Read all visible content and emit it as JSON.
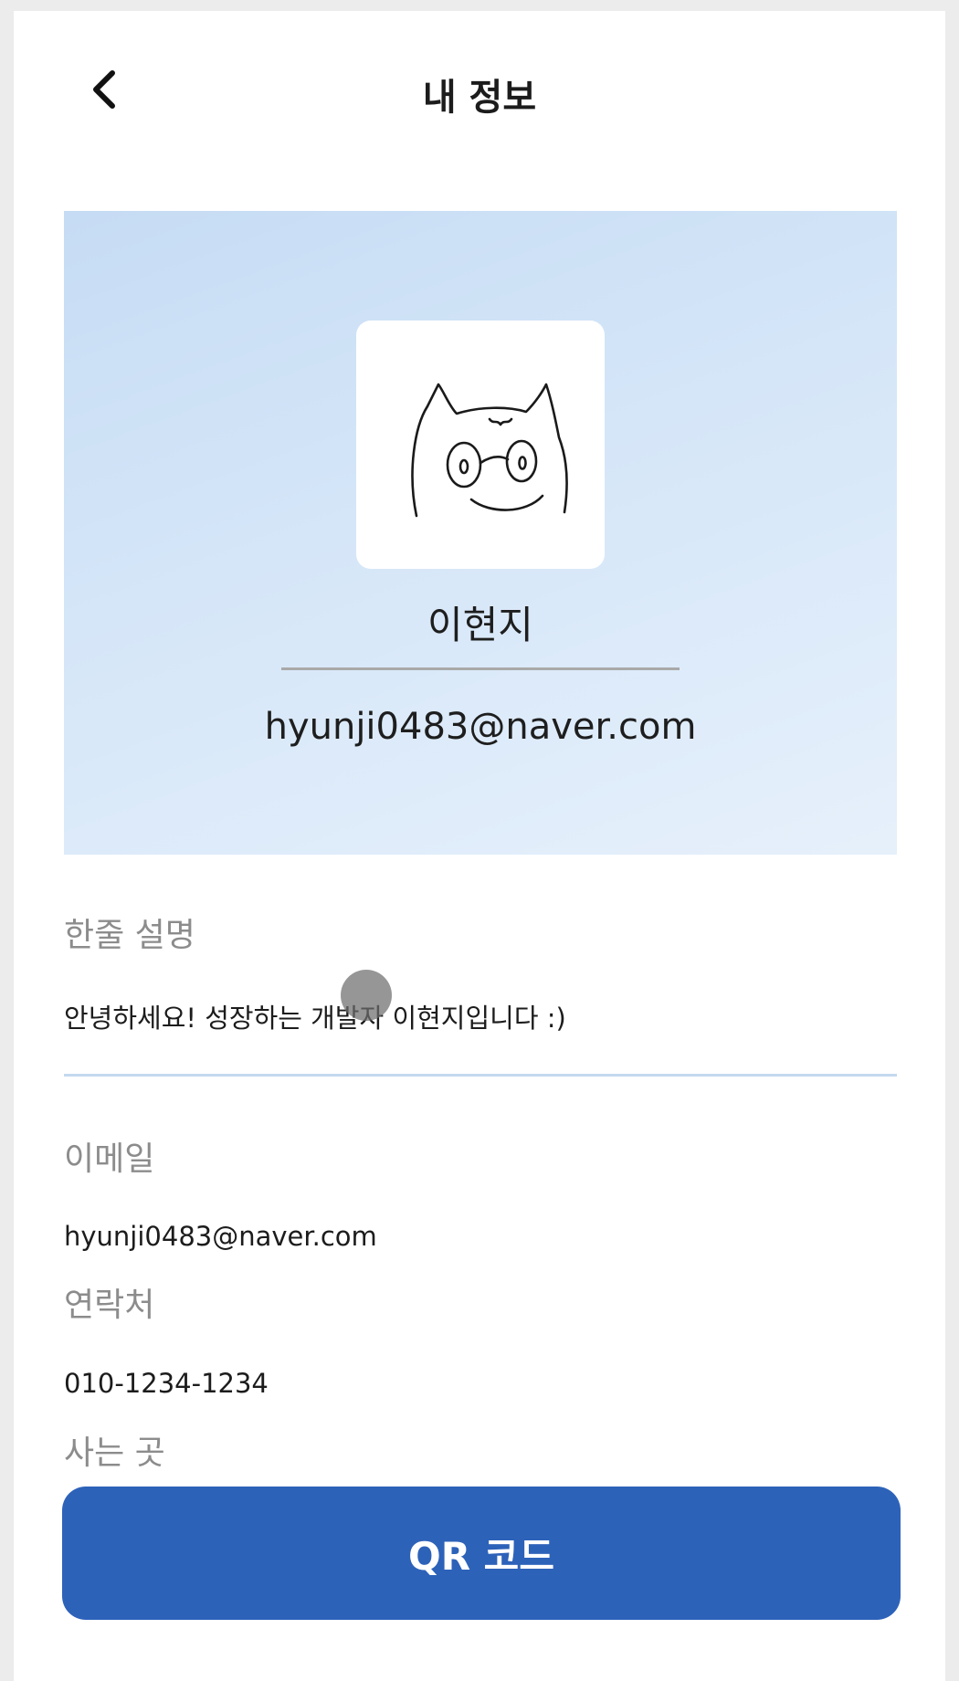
{
  "header": {
    "back_icon": "chevron-left-icon",
    "title": "내 정보"
  },
  "profile": {
    "avatar_icon": "cat-face-illustration",
    "name": "이현지",
    "email": "hyunji0483@naver.com",
    "card_color": "#cfe2f6"
  },
  "fields": {
    "bio_label": "한줄 설명",
    "bio_value": "안녕하세요! 성장하는 개발자 이현지입니다 :)",
    "email_label": "이메일",
    "email_value": "hyunji0483@naver.com",
    "phone_label": "연락처",
    "phone_value": "010-1234-1234",
    "address_label": "사는 곳"
  },
  "qr_button": {
    "label": "QR 코드",
    "color": "#2d62b9"
  }
}
